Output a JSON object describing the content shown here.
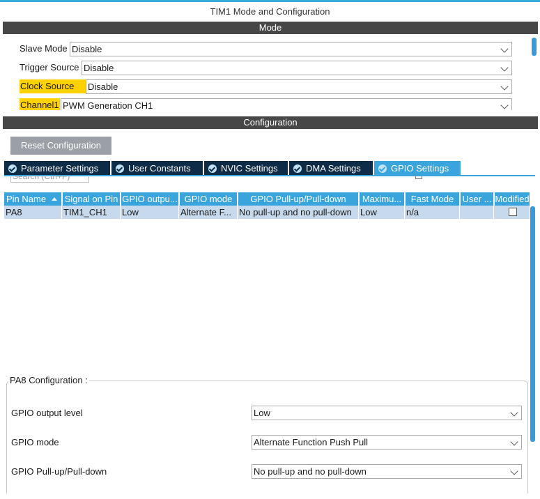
{
  "window": {
    "title": "TIM1 Mode and Configuration"
  },
  "mode_section": {
    "header": "Mode",
    "rows": [
      {
        "label": "Slave Mode",
        "value": "Disable",
        "highlighted": false
      },
      {
        "label": "Trigger Source",
        "value": "Disable",
        "highlighted": false
      },
      {
        "label": "Clock Source",
        "value": "Disable",
        "highlighted": true
      },
      {
        "label": "Channel1",
        "value": "PWM Generation CH1",
        "highlighted": true
      }
    ]
  },
  "config_section": {
    "header": "Configuration",
    "reset_button": "Reset Configuration",
    "tabs": [
      {
        "label": "Parameter Settings",
        "active": false
      },
      {
        "label": "User Constants",
        "active": false
      },
      {
        "label": "NVIC Settings",
        "active": false
      },
      {
        "label": "DMA Settings",
        "active": false
      },
      {
        "label": "GPIO Settings",
        "active": true
      }
    ],
    "search_placeholder": "Search (Ctrl+F)",
    "grid": {
      "columns": [
        "Pin Name",
        "Signal on Pin",
        "GPIO outpu...",
        "GPIO mode",
        "GPIO Pull-up/Pull-down",
        "Maximu...",
        "Fast Mode",
        "User ...",
        "Modified"
      ],
      "rows": [
        {
          "pin_name": "PA8",
          "signal": "TIM1_CH1",
          "output_level": "Low",
          "mode": "Alternate F...",
          "pull": "No pull-up and no pull-down",
          "max_speed": "Low",
          "fast_mode": "n/a",
          "user_label": "",
          "modified": false
        }
      ]
    },
    "pin_config": {
      "legend": "PA8 Configuration :",
      "fields": [
        {
          "label": "GPIO output level",
          "value": "Low"
        },
        {
          "label": "GPIO mode",
          "value": "Alternate Function Push Pull"
        },
        {
          "label": "GPIO Pull-up/Pull-down",
          "value": "No pull-up and no pull-down"
        }
      ]
    }
  },
  "colors": {
    "accent": "#3aa5dd",
    "tab_inactive": "#0e2b47",
    "section_band": "#474747",
    "highlight": "#ffd100",
    "selected_row": "#c7d9ec",
    "button_gray": "#9aa0a6"
  },
  "icons": {
    "dropdown": "chevron-down-icon",
    "tab_status": "check-circle-icon",
    "sort": "sort-ascending-icon"
  }
}
